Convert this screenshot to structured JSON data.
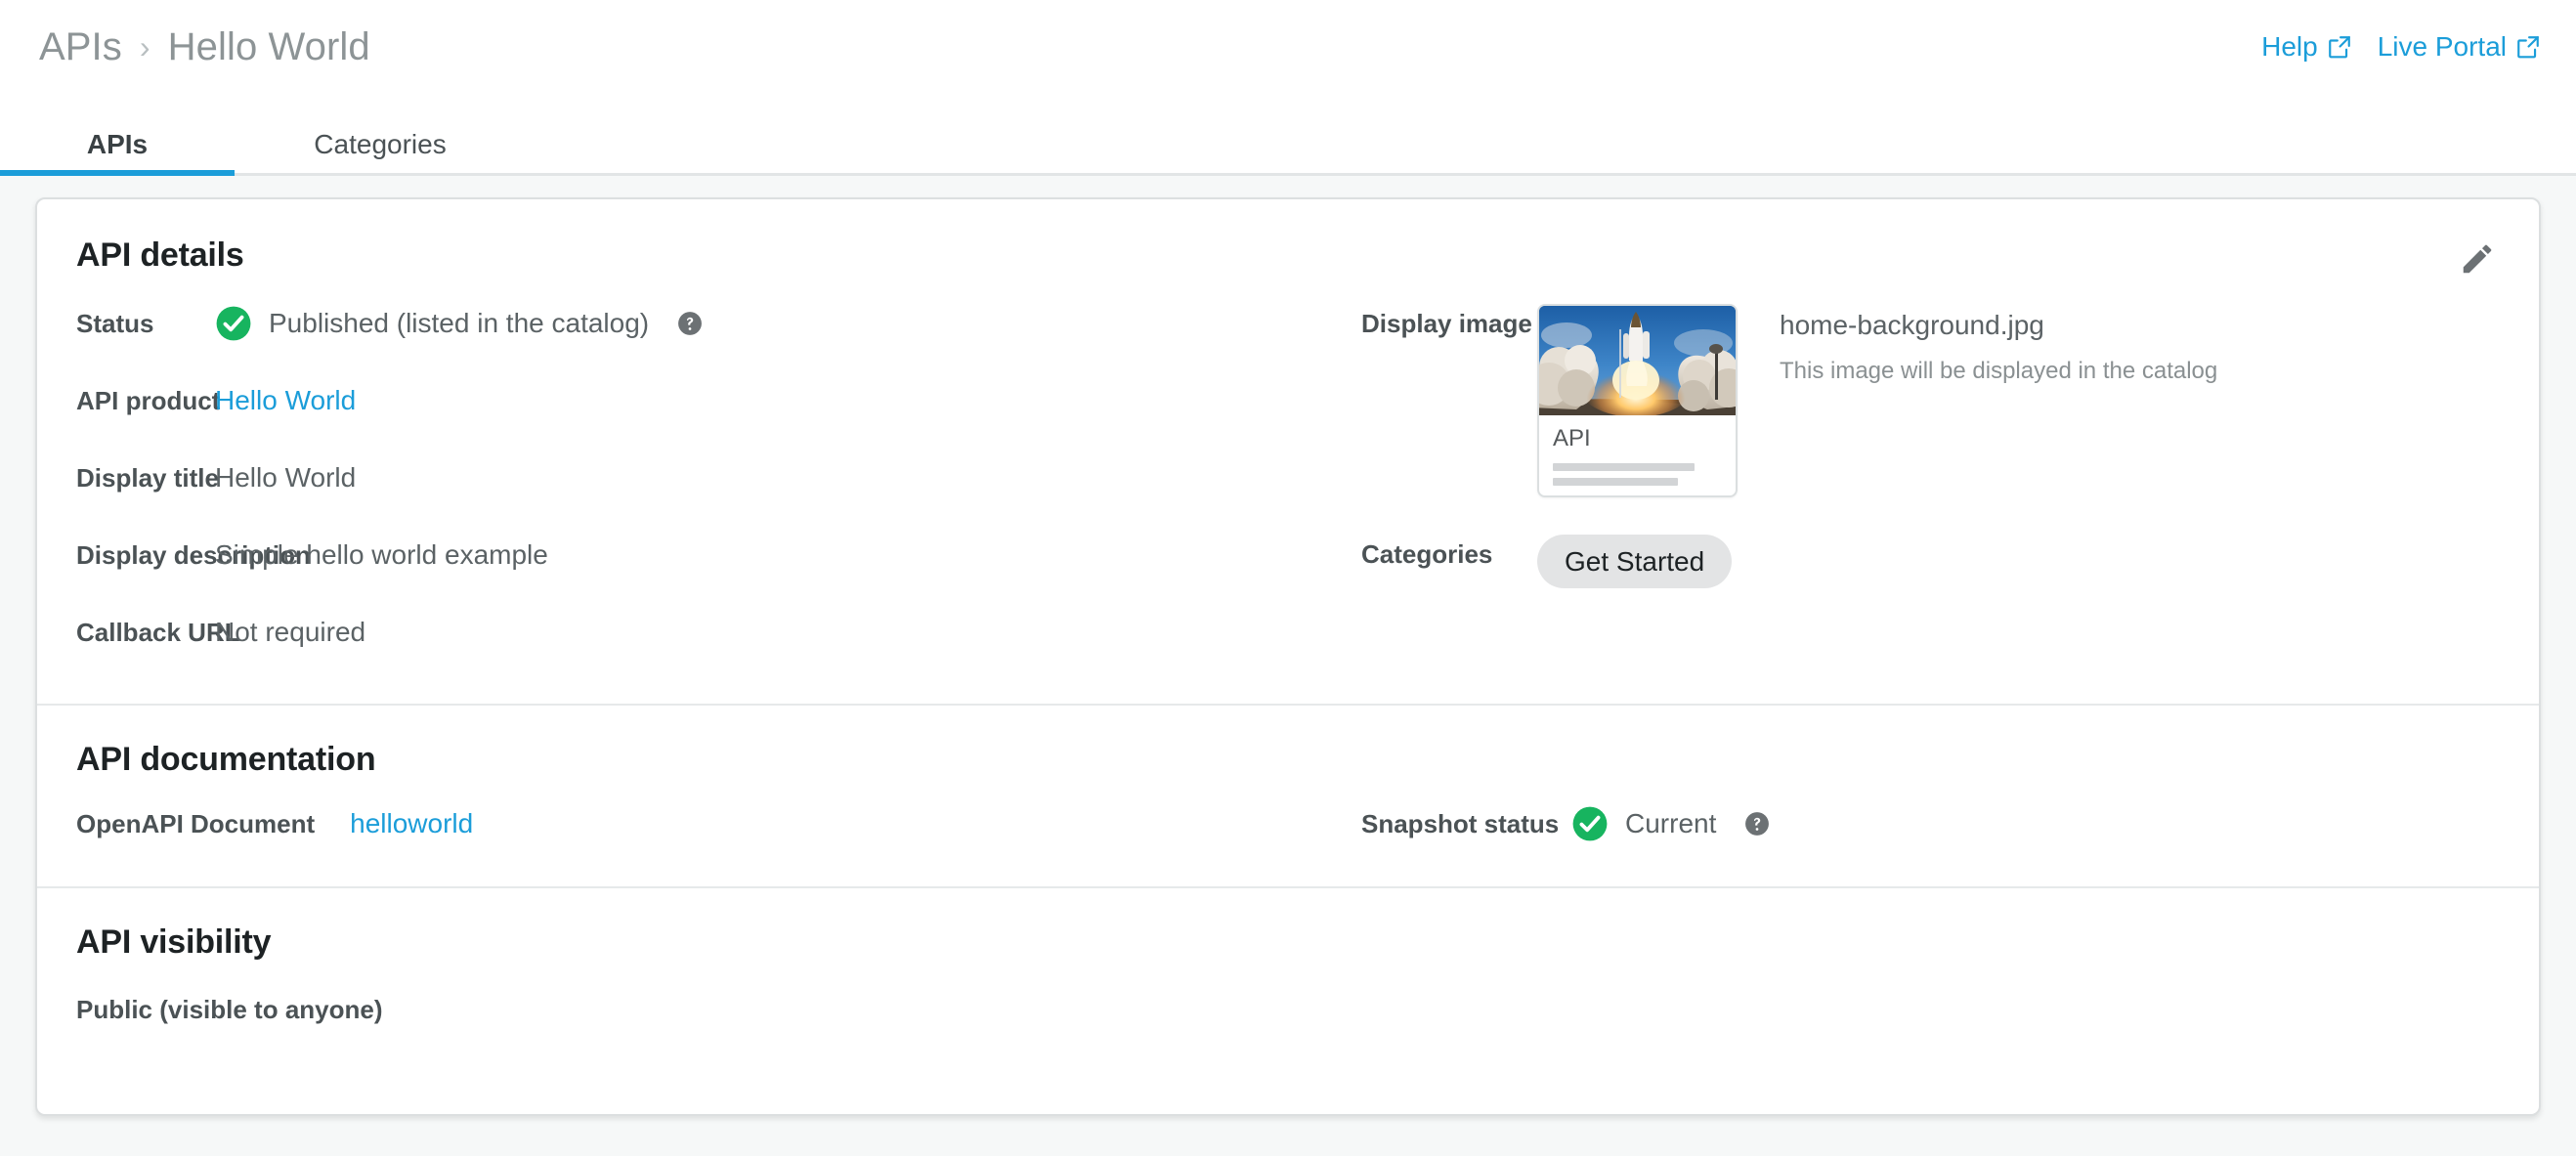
{
  "breadcrumb": {
    "root": "APIs",
    "separator": "›",
    "current": "Hello World"
  },
  "header_links": [
    {
      "label": "Help",
      "icon": "external-link-icon"
    },
    {
      "label": "Live Portal",
      "icon": "external-link-icon"
    }
  ],
  "tabs": [
    {
      "label": "APIs",
      "active": true
    },
    {
      "label": "Categories",
      "active": false
    }
  ],
  "api_details": {
    "title": "API details",
    "edit_icon": "pencil-icon",
    "rows": [
      {
        "label": "Status",
        "value": "Published (listed in the catalog)",
        "icon": "check-circle-icon",
        "help": "help-circle-icon"
      },
      {
        "label": "API product",
        "value": "Hello World",
        "is_link": true
      },
      {
        "label": "Display title",
        "value": "Hello World"
      },
      {
        "label": "Display description",
        "value": "Simple hello world example"
      },
      {
        "label": "Callback URL",
        "value": "Not required"
      }
    ],
    "display_image": {
      "label": "Display image",
      "thumbnail_caption": "API",
      "file_name": "home-background.jpg",
      "hint": "This image will be displayed in the catalog"
    },
    "categories": {
      "label": "Categories",
      "chips": [
        "Get Started"
      ]
    }
  },
  "api_documentation": {
    "title": "API documentation",
    "document_label": "OpenAPI Document",
    "document_value": "helloworld",
    "snapshot_label": "Snapshot status",
    "snapshot_value": "Current",
    "snapshot_icon": "check-circle-icon",
    "snapshot_help": "help-circle-icon"
  },
  "api_visibility": {
    "title": "API visibility",
    "value": "Public (visible to anyone)"
  },
  "colors": {
    "accent": "#1b9dd9",
    "success": "#17b45f",
    "page_bg": "#f6f8f8",
    "label_text": "#4b5255",
    "value_text": "#5b6265"
  }
}
